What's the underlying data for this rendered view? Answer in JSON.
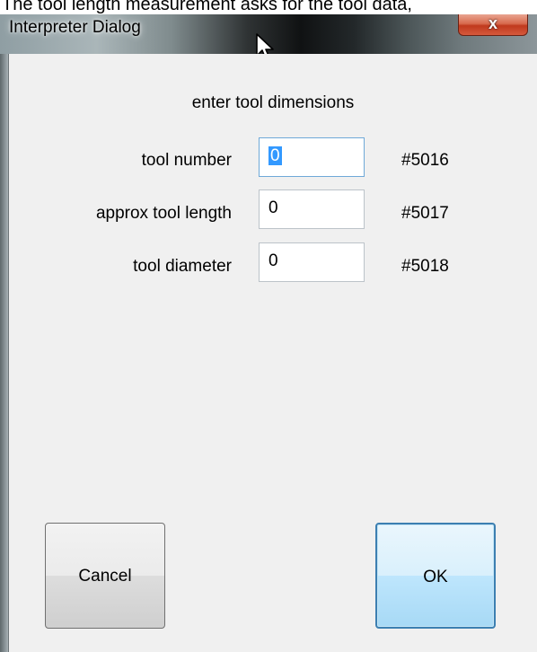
{
  "caption": {
    "text": "The tool length measurement asks for the tool data,"
  },
  "window": {
    "title": "Interpreter Dialog",
    "close_glyph": "x"
  },
  "dialog": {
    "heading": "enter tool dimensions",
    "fields": [
      {
        "label": "tool number",
        "value": "0",
        "variable": "#5016",
        "focused": true
      },
      {
        "label": "approx tool length",
        "value": "0",
        "variable": "#5017",
        "focused": false
      },
      {
        "label": "tool diameter",
        "value": "0",
        "variable": "#5018",
        "focused": false
      }
    ],
    "cancel_label": "Cancel",
    "ok_label": "OK"
  },
  "icons": {
    "close": "close-icon",
    "cursor": "mouse-pointer-icon"
  },
  "colors": {
    "close_button": "#c7432a",
    "ok_border": "#3c7fb1",
    "selection": "#3399ff"
  }
}
